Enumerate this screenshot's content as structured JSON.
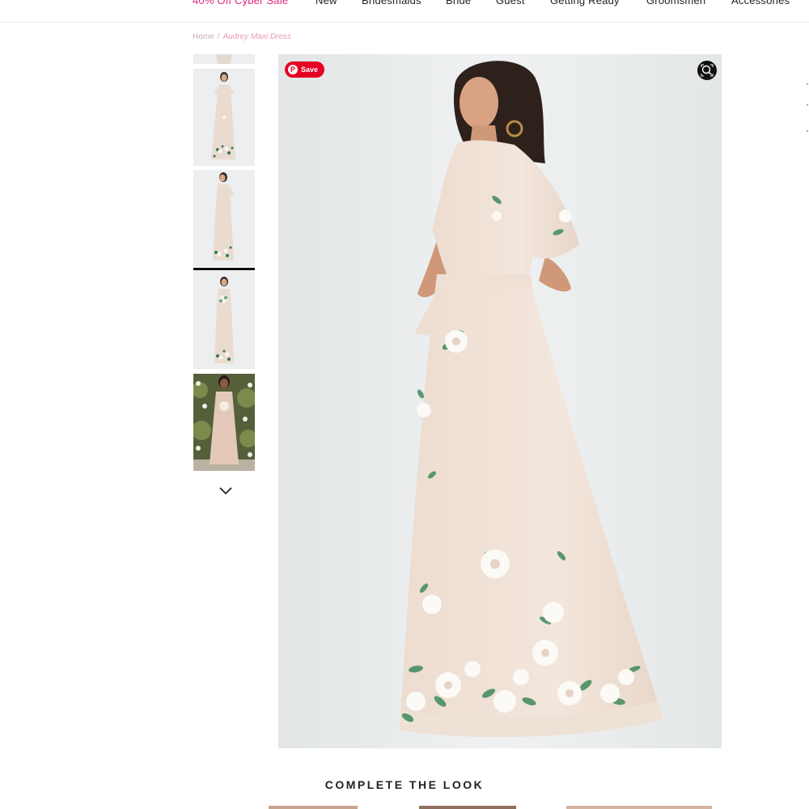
{
  "nav": {
    "items": [
      "40% Off Cyber Sale",
      "New",
      "Bridesmaids",
      "Bride",
      "Guest",
      "Getting Ready",
      "Groomsmen",
      "Accessories"
    ]
  },
  "breadcrumb": {
    "home": "Home",
    "separator": "/",
    "current": "Audrey Maxi Dress"
  },
  "gallery": {
    "thumbnails": [
      {
        "name": "front-partial"
      },
      {
        "name": "front"
      },
      {
        "name": "side"
      },
      {
        "name": "front-bouquet",
        "active": true
      },
      {
        "name": "garden"
      }
    ],
    "scroll_icon": "chevron-down-icon"
  },
  "main_image": {
    "save_label": "Save",
    "save_icon": "pinterest-icon",
    "zoom_icon": "zoom-icon"
  },
  "complete_the_look": {
    "title": "COMPLETE THE LOOK"
  },
  "colors": {
    "accent": "#e0287a",
    "pinterest": "#e60023",
    "breadcrumb": "#e89aba"
  }
}
